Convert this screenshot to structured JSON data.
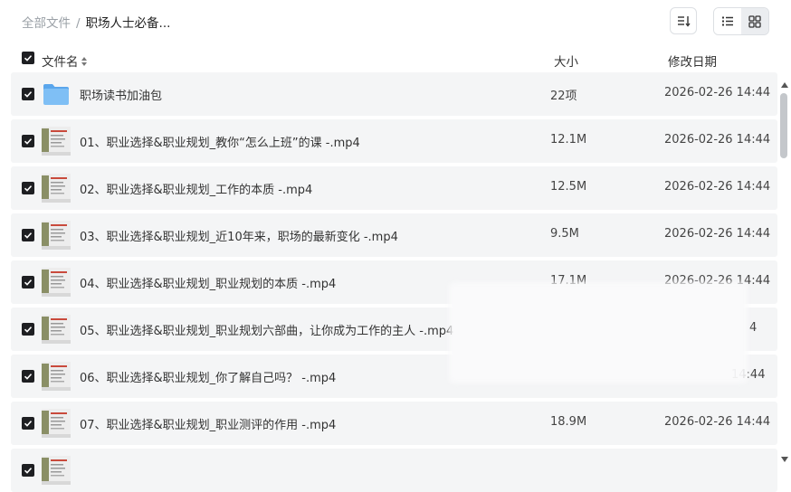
{
  "breadcrumb": {
    "root": "全部文件",
    "separator": "/",
    "current": "职场人士必备..."
  },
  "columns": {
    "name": "文件名",
    "size": "大小",
    "modified": "修改日期"
  },
  "files": [
    {
      "name": "职场读书加油包",
      "size": "22项",
      "modified": "2026-02-26 14:44",
      "type": "folder",
      "checked": true
    },
    {
      "name": "01、职业选择&职业规划_教你“怎么上班”的课 -.mp4",
      "size": "12.1M",
      "modified": "2026-02-26 14:44",
      "type": "video",
      "checked": true
    },
    {
      "name": "02、职业选择&职业规划_工作的本质 -.mp4",
      "size": "12.5M",
      "modified": "2026-02-26 14:44",
      "type": "video",
      "checked": true
    },
    {
      "name": "03、职业选择&职业规划_近10年来，职场的最新变化 -.mp4",
      "size": "9.5M",
      "modified": "2026-02-26 14:44",
      "type": "video",
      "checked": true
    },
    {
      "name": "04、职业选择&职业规划_职业规划的本质 -.mp4",
      "size": "17.1M",
      "modified": "2026-02-26 14:44",
      "type": "video",
      "checked": true
    },
    {
      "name": "05、职业选择&职业规划_职业规划六部曲，让你成为工作的主人 -.mp4",
      "size": "",
      "modified": "4",
      "type": "video",
      "checked": true
    },
    {
      "name": "06、职业选择&职业规划_你了解自己吗？ -.mp4",
      "size": "",
      "modified": "14:44",
      "type": "video",
      "checked": true
    },
    {
      "name": "07、职业选择&职业规划_职业测评的作用 -.mp4",
      "size": "18.9M",
      "modified": "2026-02-26 14:44",
      "type": "video",
      "checked": true
    },
    {
      "name": "",
      "size": "",
      "modified": "",
      "type": "video",
      "checked": true
    }
  ],
  "icons": {
    "sort": "sort-lines-icon",
    "list_view": "list-view-icon",
    "grid_view": "grid-view-icon",
    "folder": "folder-icon",
    "checkbox": "checkbox-checked-icon"
  },
  "colors": {
    "row_bg": "#f4f5f6",
    "checkbox": "#1e1f22",
    "folder": "#6cb2f2"
  }
}
